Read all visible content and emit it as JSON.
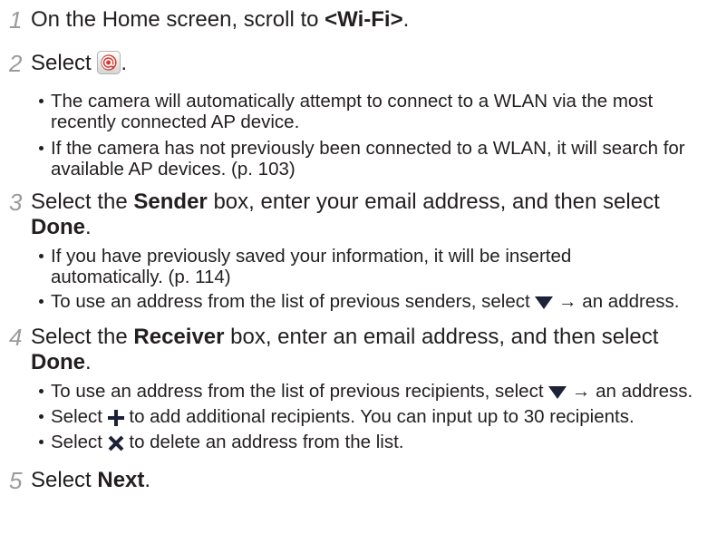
{
  "colors": {
    "text": "#231f20",
    "step_number": "#9b9b9b",
    "icon": "#1d2238",
    "email_icon_red": "#d63a2f"
  },
  "steps": [
    {
      "number": "1",
      "lines": [
        [
          "On the Home screen, scroll to ",
          "<Wi-Fi>",
          "."
        ]
      ]
    },
    {
      "number": "2",
      "icon": "email-icon",
      "lines": [
        [
          "Select ",
          "."
        ]
      ],
      "bullets": [
        {
          "lines": [
            [
              "The camera will automatically attempt to connect to a WLAN via the most"
            ],
            [
              "recently connected AP device."
            ]
          ]
        },
        {
          "lines": [
            [
              "If the camera has not previously been connected to a WLAN, it will search for"
            ],
            [
              "available AP devices. (p. 103)"
            ]
          ]
        }
      ]
    },
    {
      "number": "3",
      "lines": [
        [
          "Select the ",
          "Sender",
          " box, enter your email address, and then select"
        ],
        [
          "Done",
          "."
        ]
      ],
      "bullets": [
        {
          "lines": [
            [
              "If you have previously saved your information, it will be inserted"
            ],
            [
              "automatically. (p. 114)"
            ]
          ]
        },
        {
          "icon": "dropdown-triangle-icon",
          "lines": [
            [
              "To use an address from the list of previous senders, select ",
              " → an address."
            ]
          ]
        }
      ]
    },
    {
      "number": "4",
      "lines": [
        [
          "Select the ",
          "Receiver",
          " box, enter an email address, and then select"
        ],
        [
          "Done",
          "."
        ]
      ],
      "bullets": [
        {
          "icon": "dropdown-triangle-icon",
          "lines": [
            [
              "To use an address from the list of previous recipients, select ",
              " → an address."
            ]
          ]
        },
        {
          "icon": "plus-icon",
          "lines": [
            [
              "Select ",
              " to add additional recipients. You can input up to 30 recipients."
            ]
          ]
        },
        {
          "icon": "delete-x-icon",
          "lines": [
            [
              "Select ",
              " to delete an address from the list."
            ]
          ]
        }
      ]
    },
    {
      "number": "5",
      "lines": [
        [
          "Select ",
          "Next",
          "."
        ]
      ]
    }
  ]
}
